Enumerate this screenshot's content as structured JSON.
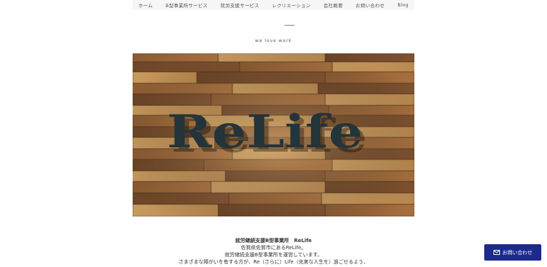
{
  "nav": {
    "items": [
      {
        "label": "ホーム"
      },
      {
        "label": "B型事業所サービス"
      },
      {
        "label": "就労支援サービス"
      },
      {
        "label": "レクリエーション"
      },
      {
        "label": "会社概要"
      },
      {
        "label": "お問い合わせ"
      },
      {
        "label": "Blog"
      }
    ]
  },
  "hero": {
    "tagline": "we love work",
    "sign_text": "ReLife"
  },
  "info": {
    "name": "就労継続支援B型事業所　ReLife",
    "line1": "佐賀県佐賀市にあるReLife。",
    "line2": "就労継続支援B型事業所を運営しています。",
    "line3": "さまざまな障がいを有する方が、Re（さらに）Life（充実な人生を）過ごせるよう、"
  },
  "contact_button": {
    "label": "お問い合わせ",
    "icon": "envelope-icon",
    "color": "#1c2a8c"
  }
}
